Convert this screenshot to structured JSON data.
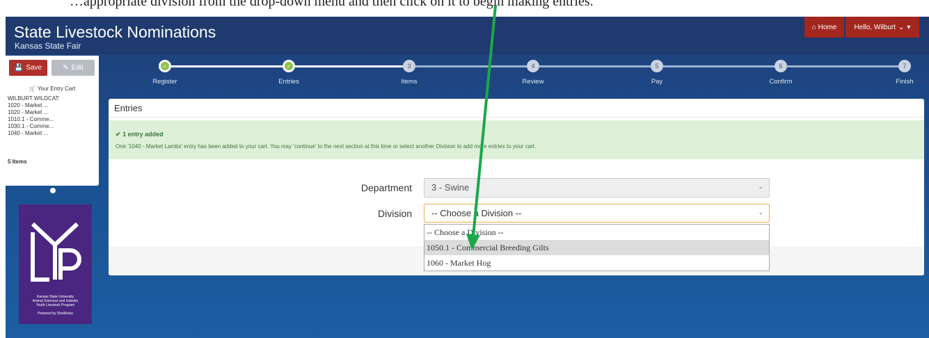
{
  "caption": "…appropriate division from the drop-down menu and then click on it to begin making entries.",
  "app": {
    "title": "State Livestock Nominations",
    "subtitle": "Kansas State Fair"
  },
  "nav": {
    "home_label": "Home",
    "user_label": "Hello, Wilburt"
  },
  "sidebar": {
    "save_label": "Save",
    "edit_label": "Edit",
    "cart_heading": "Your Entry Cart",
    "owner": "WILBURT WILDCAT:",
    "items": [
      "1020 - Market ...",
      "1020 - Market ...",
      "1010.1 - Comme...",
      "1030.1 - Comme...",
      "1040 - Market ..."
    ],
    "count": "5 Items"
  },
  "logo": {
    "letters": "LYP",
    "line1": "Kansas State University",
    "line2": "Animal Sciences and Industry",
    "line3": "Youth Livestock Program",
    "powered": "Powered by ShoWorks"
  },
  "steps": [
    {
      "num": "1",
      "label": "Register",
      "state": "done"
    },
    {
      "num": "2",
      "label": "Entries",
      "state": "done"
    },
    {
      "num": "3",
      "label": "Items",
      "state": "todo"
    },
    {
      "num": "4",
      "label": "Review",
      "state": "todo"
    },
    {
      "num": "5",
      "label": "Pay",
      "state": "todo"
    },
    {
      "num": "6",
      "label": "Confirm",
      "state": "todo"
    },
    {
      "num": "7",
      "label": "Finish",
      "state": "todo"
    }
  ],
  "card": {
    "title": "Entries"
  },
  "alert": {
    "title": "1 entry added",
    "text": "One '1040 - Market Lambs' entry has been added to your cart. You may 'continue' to the next section at this time or select another Division to add more entries to your cart."
  },
  "form": {
    "department_label": "Department",
    "department_value": "3 - Swine",
    "division_label": "Division",
    "division_value": "-- Choose a Division --",
    "division_options": [
      "-- Choose a Division --",
      "1050.1 - Commercial Breeding Gilts",
      "1060 - Market Hog"
    ],
    "highlighted_option": "1050.1 - Commercial Breeding Gilts"
  },
  "colors": {
    "header": "#1e3a6e",
    "nav_red": "#a3271e",
    "step_done": "#8bc34a",
    "alert_bg": "#dff0d8",
    "logo_purple": "#4b2680",
    "arrow": "#1aa84a"
  },
  "icons": {
    "save": "floppy-disk-icon",
    "edit": "pencil-icon",
    "cart": "cart-icon",
    "home": "home-icon",
    "check": "check-icon"
  }
}
